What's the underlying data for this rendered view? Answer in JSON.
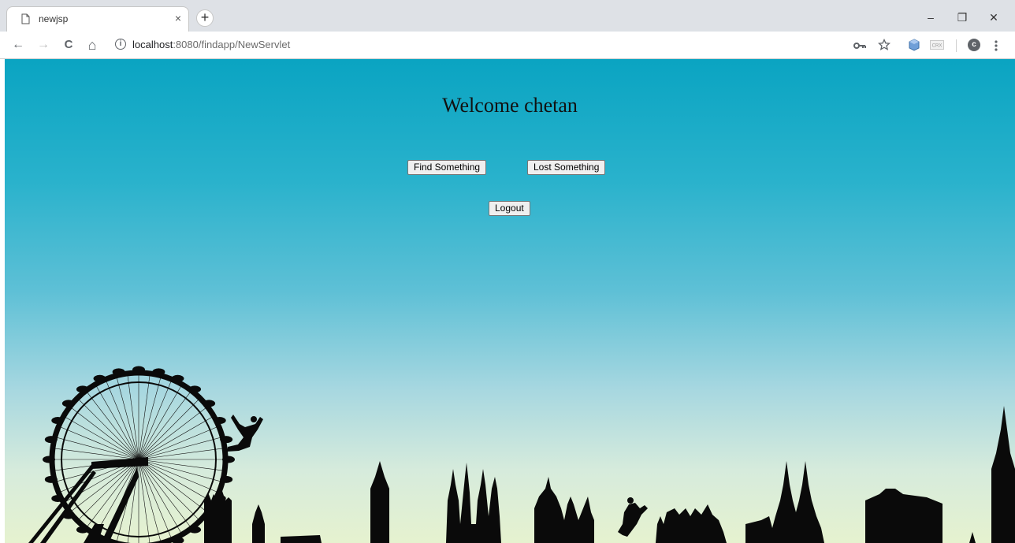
{
  "browser": {
    "tab_title": "newjsp",
    "tab_close": "×",
    "new_tab": "+",
    "url_host": "localhost",
    "url_rest": ":8080/findapp/NewServlet",
    "profile_initial": "c",
    "window_controls": {
      "minimize": "–",
      "restore": "❐",
      "close": "✕"
    },
    "nav": {
      "back": "←",
      "forward": "→",
      "reload": "C",
      "home": "⌂",
      "info": "i"
    },
    "toolbar_icons": [
      "key-icon",
      "star-icon",
      "extension-cube-icon",
      "crx-extension-icon",
      "profile-icon",
      "menu-icon"
    ]
  },
  "page": {
    "welcome_text": "Welcome chetan",
    "find_button": "Find Something",
    "lost_button": "Lost Something",
    "logout_button": "Logout"
  },
  "colors": {
    "sky_top": "#0aa4c2",
    "sky_bottom": "#e6f2cf",
    "silhouette": "#0a0a0a"
  }
}
